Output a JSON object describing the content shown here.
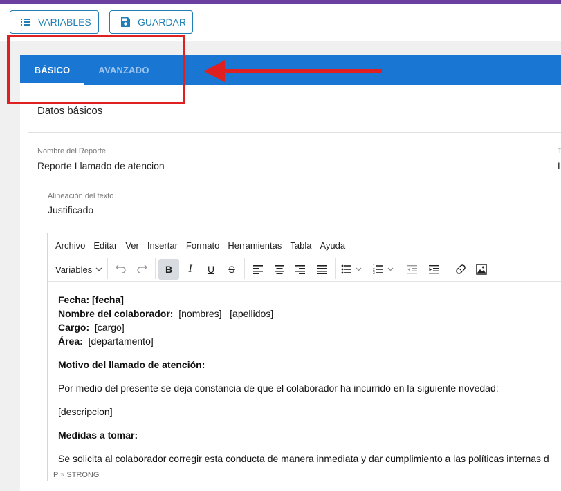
{
  "toolbar": {
    "variables_label": "VARIABLES",
    "save_label": "GUARDAR"
  },
  "tabs": [
    {
      "label": "BÁSICO",
      "active": true
    },
    {
      "label": "AVANZADO",
      "active": false
    }
  ],
  "section": {
    "title": "Datos básicos"
  },
  "fields": {
    "report_name": {
      "label": "Nombre del Reporte",
      "value": "Reporte Llamado de atencion"
    },
    "right_label_fragment": "T",
    "right_value_fragment": "L",
    "alignment": {
      "label": "Alineación del texto",
      "value": "Justificado"
    }
  },
  "editor": {
    "menu": [
      "Archivo",
      "Editar",
      "Ver",
      "Insertar",
      "Formato",
      "Herramientas",
      "Tabla",
      "Ayuda"
    ],
    "variables_dropdown": "Variables",
    "content": {
      "fecha_label": "Fecha:",
      "fecha_value": "[fecha]",
      "colaborador_label": "Nombre del colaborador:",
      "colaborador_nombres": "[nombres]",
      "colaborador_apellidos": "[apellidos]",
      "cargo_label": "Cargo:",
      "cargo_value": "[cargo]",
      "area_label": "Área:",
      "area_value": "[departamento]",
      "motivo_heading": "Motivo del llamado de atención:",
      "motivo_text": "Por medio del presente se deja constancia de que el colaborador ha incurrido en la siguiente novedad:",
      "descripcion": "[descripcion]",
      "medidas_heading": "Medidas a tomar:",
      "medidas_text": "Se solicita al colaborador corregir esta conducta de manera inmediata y dar cumplimiento a las políticas internas d"
    },
    "status_path": "P » STRONG"
  },
  "colors": {
    "accent": "#1976d2",
    "top_bar": "#6b3fa0",
    "annotation": "#e02020"
  }
}
